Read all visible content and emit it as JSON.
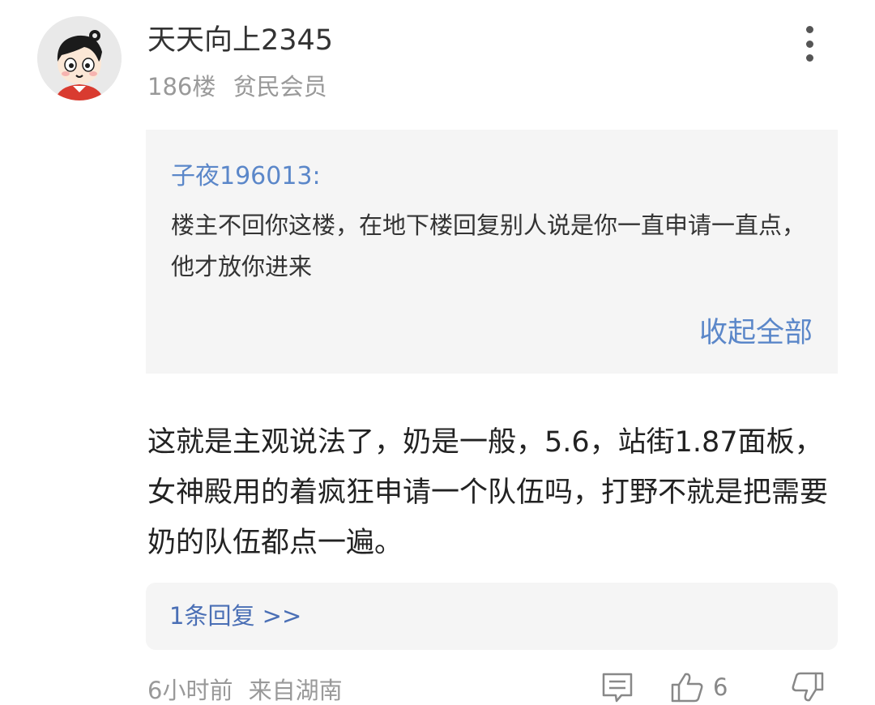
{
  "post": {
    "user": {
      "avatar_icon": "cartoon-avatar",
      "name": "天天向上2345",
      "floor": "186楼",
      "member_level": "贫民会员"
    },
    "quote": {
      "author": "子夜196013:",
      "text": "楼主不回你这楼，在地下楼回复别人说是你一直申请一直点，他才放你进来",
      "collapse_label": "收起全部"
    },
    "body": "这就是主观说法了，奶是一般，5.6，站街1.87面板，女神殿用的着疯狂申请一个队伍吗，打野不就是把需要奶的队伍都点一遍。",
    "replies_label": "1条回复 >>",
    "time": "6小时前",
    "location": "来自湖南",
    "like_count": "6",
    "icons": {
      "more": "more-vertical-icon",
      "comment": "comment-icon",
      "like": "thumbs-up-icon",
      "dislike": "thumbs-down-icon"
    },
    "colors": {
      "link": "#5b87c9",
      "meta": "#999999",
      "quote_bg": "#f5f5f5"
    }
  }
}
